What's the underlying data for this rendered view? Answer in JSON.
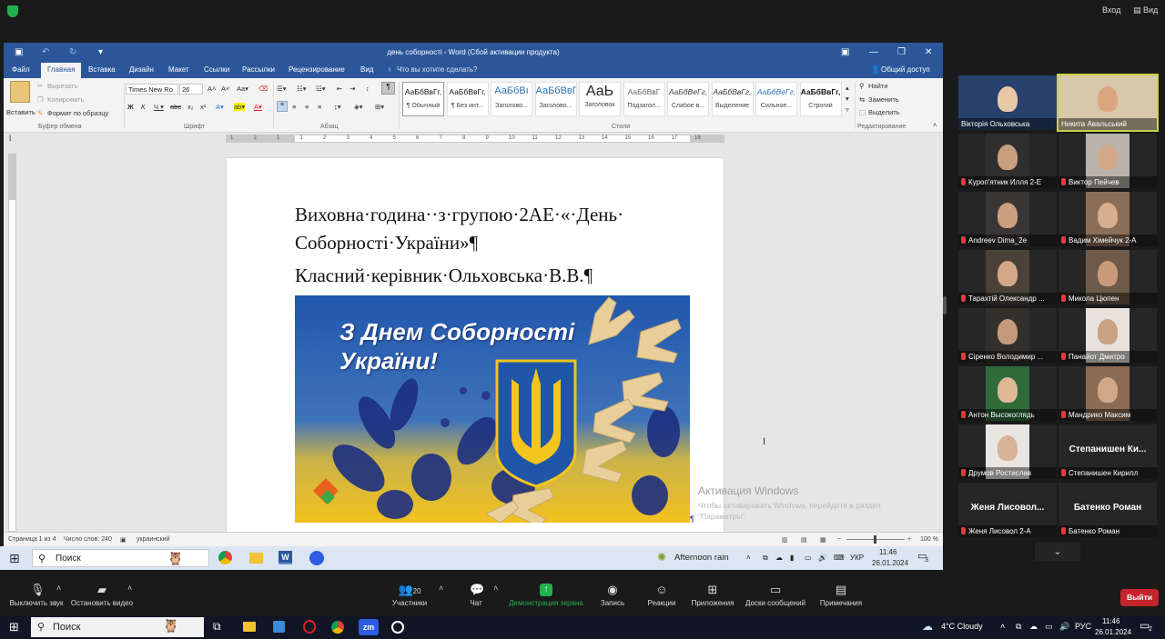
{
  "zoom_top": {
    "signin": "Вход",
    "view": "Вид"
  },
  "word": {
    "title": "день соборності - Word (Сбой активации продукта)",
    "tabs": [
      "Файл",
      "Главная",
      "Вставка",
      "Дизайн",
      "Макет",
      "Ссылки",
      "Рассылки",
      "Рецензирование",
      "Вид"
    ],
    "tell_me": "Что вы хотите сделать?",
    "share": "Общий доступ",
    "clipboard": {
      "paste": "Вставить",
      "cut": "Вырезать",
      "copy": "Копировать",
      "format_painter": "Формат по образцу",
      "group": "Буфер обмена"
    },
    "font": {
      "name": "Times New Ro",
      "size": "26",
      "group": "Шрифт"
    },
    "paragraph_group": "Абзац",
    "styles": [
      {
        "sample": "АаБбВвГг,",
        "name": "¶ Обычный"
      },
      {
        "sample": "АаБбВвГг,",
        "name": "¶ Без инт..."
      },
      {
        "sample": "АаБбВı",
        "name": "Заголово..."
      },
      {
        "sample": "АаБбВвГ",
        "name": "Заголово..."
      },
      {
        "sample": "АаЬ",
        "name": "Заголовок"
      },
      {
        "sample": "АаБбВвГ",
        "name": "Подзагол..."
      },
      {
        "sample": "АаБбВеГг,",
        "name": "Слабое в..."
      },
      {
        "sample": "АаБбВвГг,",
        "name": "Выделение"
      },
      {
        "sample": "АаБбВеГг,",
        "name": "Сильное..."
      },
      {
        "sample": "АаБбВвГг,",
        "name": "Строгий"
      }
    ],
    "styles_group": "Стили",
    "editing": {
      "find": "Найти",
      "replace": "Заменить",
      "select": "Выделить",
      "group": "Редактирование"
    },
    "ruler_numbers": [
      "1",
      "2",
      "1",
      "1",
      "2",
      "3",
      "4",
      "5",
      "6",
      "7",
      "8",
      "9",
      "10",
      "11",
      "12",
      "13",
      "14",
      "15",
      "16",
      "17",
      "18"
    ],
    "document": {
      "line1": "Виховна·година··з·групою·2АЕ·«·День·",
      "line2": "Соборності·України»¶",
      "line3": "Класний·керівник·Ольховська·В.В.¶",
      "banner_line1": "З Днем Соборності",
      "banner_line2": "України!",
      "pilcrow": "¶"
    },
    "status": {
      "page": "Страница 1 из 4",
      "words": "Число слов: 240",
      "lang": "украинский",
      "zoom": "100 %"
    },
    "watermark": {
      "title": "Активация Windows",
      "text": "Чтобы активировать Windows, перейдите в раздел \"Параметры\"."
    }
  },
  "inner_taskbar": {
    "search": "Поиск",
    "weather": "Afternoon rain",
    "lang": "УКР",
    "time": "11:46",
    "date": "26.01.2024",
    "badge": "3"
  },
  "participants": [
    {
      "name": "Вікторія Ольховська",
      "muted": false
    },
    {
      "name": "Никита Авальський",
      "muted": false
    },
    {
      "name": "Куроп'ятник Илля 2-Е",
      "muted": true
    },
    {
      "name": "Виктор Пейчев",
      "muted": true
    },
    {
      "name": "Andreev Dima_2e",
      "muted": true
    },
    {
      "name": "Вадим Хімейчук 2-А",
      "muted": true
    },
    {
      "name": "Тарахтій Олександр ...",
      "muted": true
    },
    {
      "name": "Микола Цюпен",
      "muted": true
    },
    {
      "name": "Сіренко Володимир ...",
      "muted": true
    },
    {
      "name": "Панайот Дмитро",
      "muted": true
    },
    {
      "name": "Антон Высокоглядь",
      "muted": true
    },
    {
      "name": "Мандрико Максим",
      "muted": true
    },
    {
      "name": "Друмов Ростислав",
      "muted": true
    },
    {
      "name": "Степанишен Кирилл",
      "muted": true,
      "big": "Степанишен Ки..."
    },
    {
      "name": "Женя Лисовол 2-А",
      "muted": true,
      "big": "Женя Лисовол..."
    },
    {
      "name": "Батенко Роман",
      "muted": true,
      "big": "Батенко Роман"
    }
  ],
  "zoom_controls": {
    "mute": "Выключить звук",
    "video": "Остановить видео",
    "participants": "Участники",
    "participants_count": "20",
    "chat": "Чат",
    "share": "Демонстрация экрана",
    "record": "Запись",
    "reactions": "Реакции",
    "apps": "Приложения",
    "whiteboards": "Доски сообщений",
    "notes": "Примечания",
    "leave": "Выйти"
  },
  "outer_taskbar": {
    "search": "Поиск",
    "weather": "4°C Cloudy",
    "lang": "РУС",
    "time": "11:46",
    "date": "26.01.2024",
    "badge": "2"
  },
  "colors": {
    "word_blue": "#2b579a",
    "share_green": "#23b14d",
    "leave_red": "#c4242b",
    "ukr_blue": "#1f56a8",
    "ukr_yellow": "#f4c51c"
  }
}
